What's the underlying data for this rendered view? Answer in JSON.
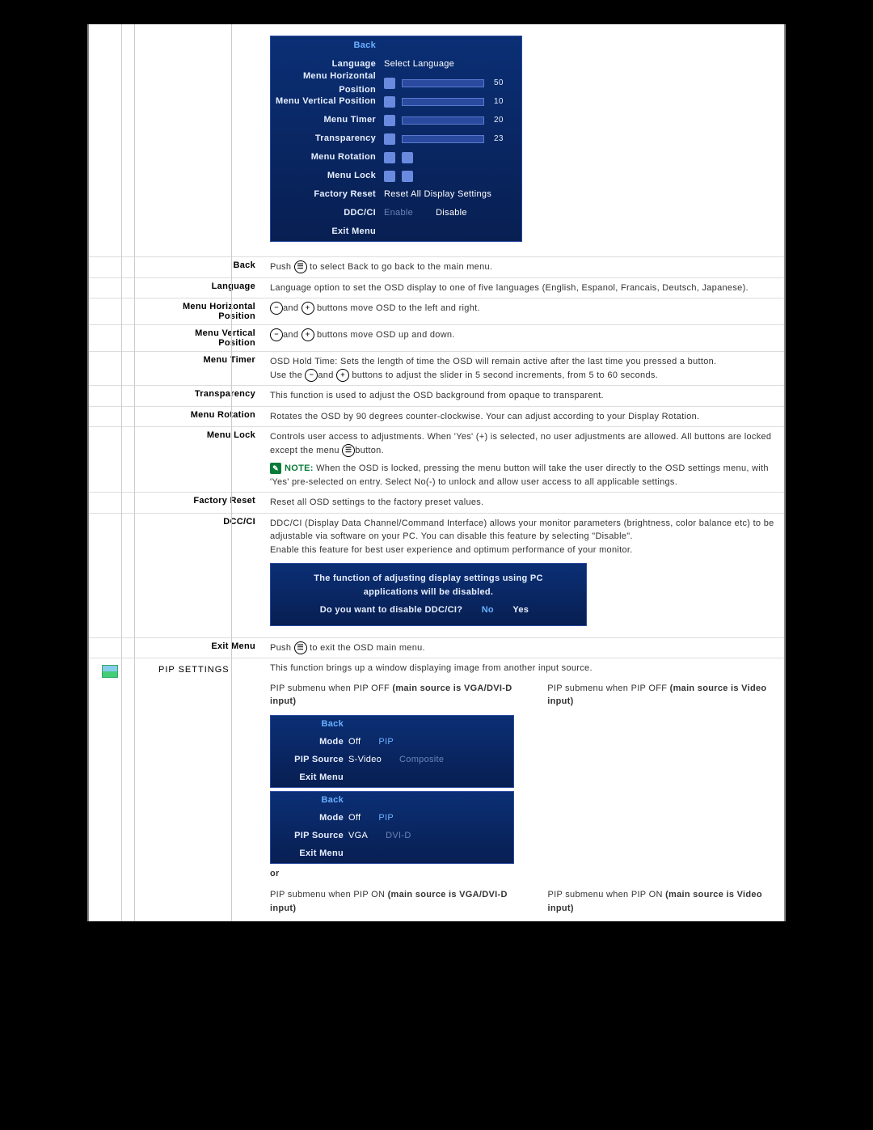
{
  "osd_main": {
    "items": [
      {
        "label": "Back",
        "selected": true,
        "right": ""
      },
      {
        "label": "Language",
        "right": "Select Language"
      },
      {
        "label": "Menu Horizontal Position",
        "value": 50
      },
      {
        "label": "Menu Vertical Position",
        "value": 10
      },
      {
        "label": "Menu Timer",
        "value": 20
      },
      {
        "label": "Transparency",
        "value": 23
      },
      {
        "label": "Menu Rotation",
        "icons": true
      },
      {
        "label": "Menu Lock",
        "icons": true
      },
      {
        "label": "Factory Reset",
        "right": "Reset All Display Settings"
      },
      {
        "label": "DDC/CI",
        "right_enable": "Enable",
        "right_disable": "Disable"
      },
      {
        "label": "Exit Menu",
        "right": ""
      }
    ]
  },
  "rows": {
    "back_label": "Back",
    "back_body_a": "Push ",
    "back_body_b": "to select Back to go back to the main menu.",
    "language_label": "Language",
    "language_body": "Language option to set the OSD display to one of five languages (English, Espanol, Francais, Deutsch, Japanese).",
    "hpos_label": "Menu Horizontal Position",
    "hpos_body_a": "and ",
    "hpos_body_b": "buttons move OSD to the left and right.",
    "vpos_label": "Menu Vertical Position",
    "vpos_body_a": "and ",
    "vpos_body_b": "buttons move OSD up and down.",
    "timer_label": "Menu Timer",
    "timer_body_1": "OSD Hold Time:  Sets the length of time the OSD will remain active after the last time you pressed a button.",
    "timer_body_2a": "Use the ",
    "timer_body_2b": "and ",
    "timer_body_2c": "buttons to adjust the slider in 5 second increments, from 5 to 60 seconds.",
    "transp_label": "Transparency",
    "transp_body": "This function is used to adjust the OSD background from opaque to transparent.",
    "rotation_label": "Menu Rotation",
    "rotation_body": "Rotates the OSD by 90 degrees counter-clockwise. Your can adjust according to your Display Rotation.",
    "lock_label": "Menu Lock",
    "lock_body_a": "Controls user access to adjustments. When 'Yes' (+) is selected, no user adjustments are allowed. All buttons are locked except the menu ",
    "lock_body_b": "button.",
    "lock_note_label": "NOTE:",
    "lock_note": " When the OSD is locked, pressing the menu button will take the user directly to the OSD settings menu, with 'Yes' pre-selected on entry. Select No(-) to unlock and allow user access to all applicable settings.",
    "freset_label": "Factory Reset",
    "freset_body": "Reset all OSD settings to the factory preset values.",
    "ddcci_label": "DCC/CI",
    "ddcci_body": "DDC/CI (Display Data Channel/Command Interface) allows your monitor parameters (brightness, color balance etc) to be adjustable via software on your PC. You can disable this feature by selecting \"Disable\".\nEnable this feature for best user experience and optimum performance of your monitor.",
    "exit_label": "Exit Menu",
    "exit_body_a": "Push ",
    "exit_body_b": "to exit the OSD main menu."
  },
  "ddc_box": {
    "line1": "The function of adjusting display settings using PC",
    "line2": "applications will be disabled.",
    "question": "Do you want to disable DDC/CI?",
    "no": "No",
    "yes": "Yes"
  },
  "pip": {
    "section": "PIP SETTINGS",
    "intro": "This function brings up a window displaying image from another input source.",
    "cap_off_pc_a": "PIP submenu when PIP OFF ",
    "cap_off_pc_b": "(main source is VGA/DVI-D input)",
    "cap_off_vid_a": "PIP submenu when PIP OFF ",
    "cap_off_vid_b": "(main source is Video input)",
    "or": "or",
    "cap_on_pc_a": "PIP submenu when PIP ON ",
    "cap_on_pc_b": "(main source is VGA/DVI-D input)",
    "cap_on_vid_a": "PIP submenu when PIP ON ",
    "cap_on_vid_b": "(main source is Video input)",
    "submenus": [
      {
        "back": "Back",
        "mode": "Mode",
        "mode_off": "Off",
        "mode_pip": "PIP",
        "src": "PIP Source",
        "src_a": "S-Video",
        "src_b": "Composite",
        "exit": "Exit Menu"
      },
      {
        "back": "Back",
        "mode": "Mode",
        "mode_off": "Off",
        "mode_pip": "PIP",
        "src": "PIP Source",
        "src_a": "VGA",
        "src_b": "DVI-D",
        "exit": "Exit Menu"
      }
    ]
  }
}
